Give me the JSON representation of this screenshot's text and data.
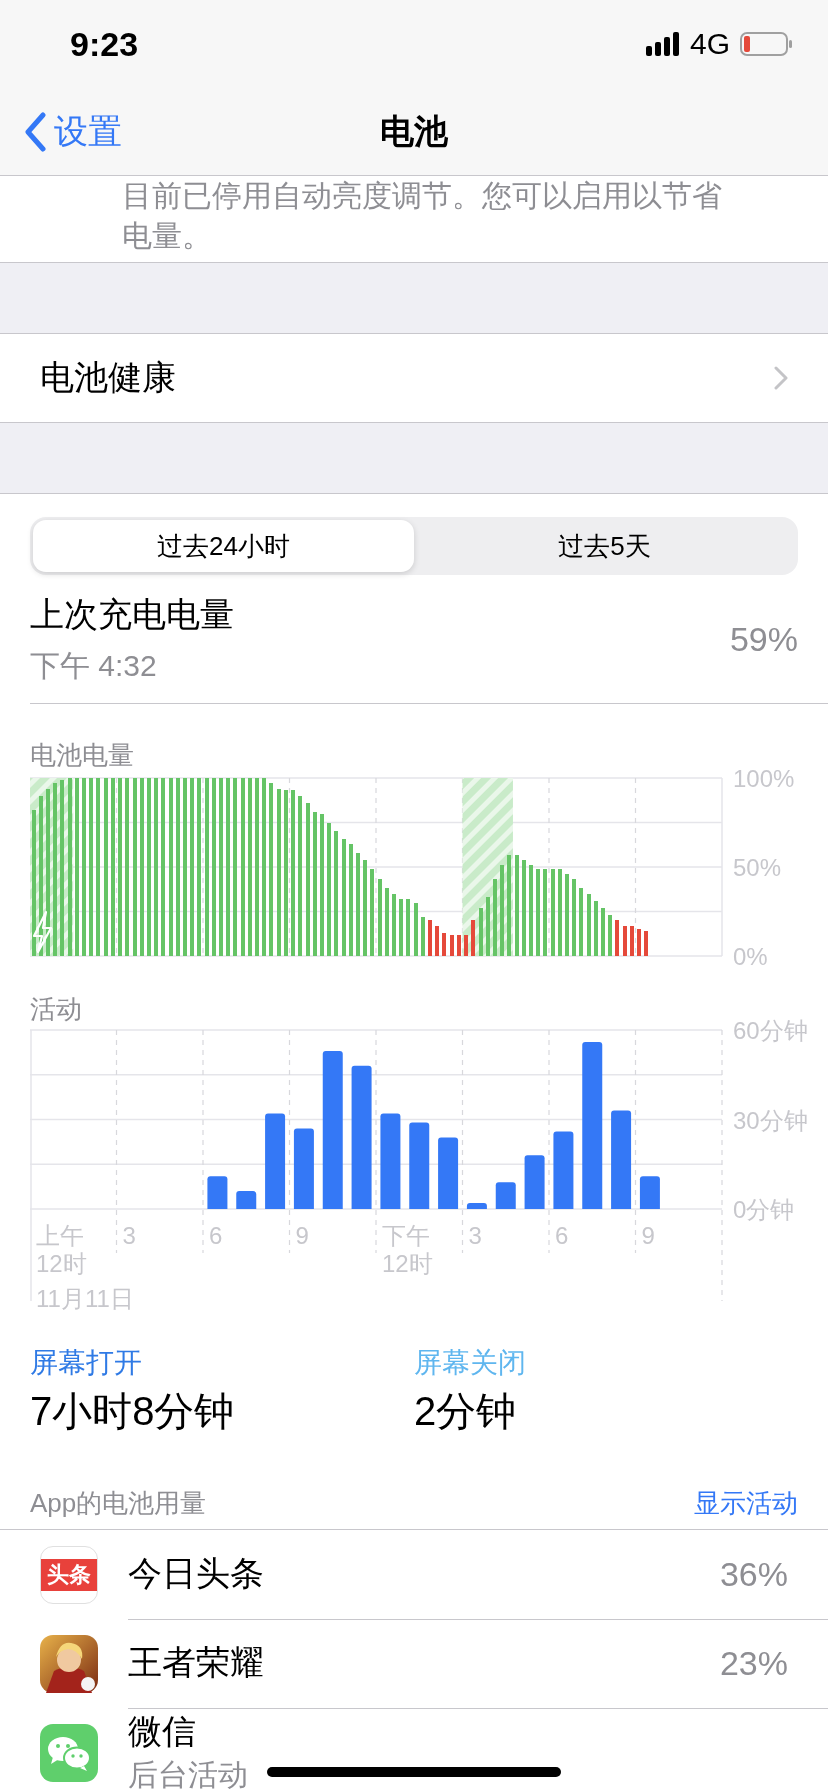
{
  "status_bar": {
    "time": "9:23",
    "network": "4G"
  },
  "nav": {
    "back": "设置",
    "title": "电池"
  },
  "brightness_note": "目前已停用自动亮度调节。您可以启用以节省电量。",
  "battery_health": {
    "label": "电池健康"
  },
  "period_tabs": [
    {
      "label": "过去24小时",
      "selected": true
    },
    {
      "label": "过去5天",
      "selected": false
    }
  ],
  "last_charge": {
    "label": "上次充电电量",
    "time": "下午 4:32",
    "value": "59%"
  },
  "battery_level": {
    "chart_data": {
      "type": "bar",
      "title": "电池电量",
      "ylim": [
        0,
        100
      ],
      "values": [
        82,
        90,
        94,
        97,
        99,
        100,
        100,
        100,
        100,
        100,
        100,
        100,
        100,
        100,
        100,
        100,
        100,
        100,
        100,
        100,
        100,
        100,
        100,
        100,
        100,
        100,
        100,
        100,
        100,
        100,
        100,
        100,
        100,
        97,
        94,
        93,
        93,
        90,
        86,
        81,
        80,
        75,
        70,
        66,
        63,
        58,
        54,
        49,
        43,
        38,
        35,
        32,
        32,
        30,
        22,
        20,
        17,
        13,
        12,
        12,
        12,
        20,
        27,
        33,
        43,
        51,
        57,
        57,
        54,
        51,
        49,
        49,
        49,
        49,
        46,
        43,
        38,
        35,
        31,
        27,
        23,
        20,
        17,
        17,
        15,
        14,
        null,
        null,
        null,
        null,
        null,
        null,
        null,
        null,
        null,
        null
      ],
      "yticks": [
        {
          "value": 0,
          "label": "0%"
        },
        {
          "value": 50,
          "label": "50%"
        },
        {
          "value": 100,
          "label": "100%"
        }
      ]
    }
  },
  "activity": {
    "chart_data": {
      "type": "bar",
      "title": "活动",
      "ylim": [
        0,
        60
      ],
      "values": [
        0,
        0,
        0,
        0,
        0,
        0,
        11,
        6,
        32,
        27,
        53,
        48,
        32,
        29,
        24,
        2,
        9,
        18,
        26,
        56,
        33,
        11,
        null,
        null
      ],
      "yticks": [
        {
          "value": 0,
          "label": "0分钟"
        },
        {
          "value": 30,
          "label": "30分钟"
        },
        {
          "value": 60,
          "label": "60分钟"
        }
      ]
    },
    "time_labels": [
      "上午\n12时",
      "3",
      "6",
      "9",
      "下午\n12时",
      "3",
      "6",
      "9"
    ],
    "date_label": "11月11日"
  },
  "screen_time": [
    {
      "label": "屏幕打开",
      "value": "7小时8分钟",
      "color": "#2f7ae5"
    },
    {
      "label": "屏幕关闭",
      "value": "2分钟",
      "color": "#5fb6ef"
    }
  ],
  "app_usage": {
    "title": "App的电池用量",
    "action": "显示活动",
    "apps": [
      {
        "kind": "news",
        "icon_text": "头条",
        "name": "今日头条",
        "value": "36%"
      },
      {
        "kind": "game",
        "name": "王者荣耀",
        "value": "23%"
      },
      {
        "kind": "chat",
        "name": "微信",
        "subtitle": "后台活动"
      }
    ]
  }
}
